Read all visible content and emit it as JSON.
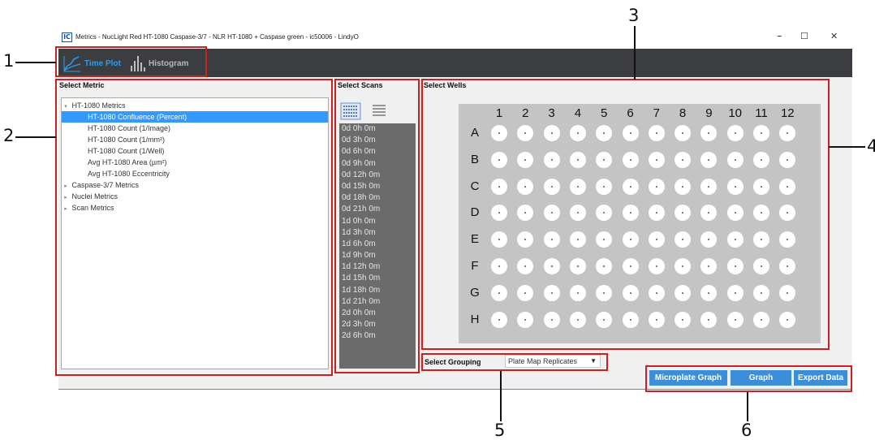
{
  "window": {
    "icon_text": "IC",
    "title": "Metrics - NucLight Red HT-1080 Caspase-3/7 - NLR HT-1080 + Caspase green - ic50006 - LindyO",
    "minimize": "–",
    "maximize": "☐",
    "close": "✕"
  },
  "toolbar": {
    "time_plot": "Time Plot",
    "histogram": "Histogram",
    "active": "Time Plot",
    "active_color": "#2e9dee"
  },
  "select_metric": {
    "label": "Select Metric",
    "tree": [
      {
        "label": "HT-1080 Metrics",
        "expanded": true,
        "level": 0
      },
      {
        "label": "HT-1080 Confluence (Percent)",
        "level": 1,
        "selected": true
      },
      {
        "label": "HT-1080 Count (1/Image)",
        "level": 1
      },
      {
        "label": "HT-1080 Count (1/mm²)",
        "level": 1
      },
      {
        "label": "HT-1080 Count (1/Well)",
        "level": 1
      },
      {
        "label": "Avg HT-1080 Area (µm²)",
        "level": 1
      },
      {
        "label": "Avg HT-1080 Eccentricity",
        "level": 1
      },
      {
        "label": "Caspase-3/7 Metrics",
        "expanded": false,
        "level": 0
      },
      {
        "label": "Nuclei Metrics",
        "expanded": false,
        "level": 0
      },
      {
        "label": "Scan Metrics",
        "expanded": false,
        "level": 0
      }
    ]
  },
  "select_scans": {
    "label": "Select Scans",
    "items": [
      "0d 0h 0m",
      "0d 3h 0m",
      "0d 6h 0m",
      "0d 9h 0m",
      "0d 12h 0m",
      "0d 15h 0m",
      "0d 18h 0m",
      "0d 21h 0m",
      "1d 0h 0m",
      "1d 3h 0m",
      "1d 6h 0m",
      "1d 9h 0m",
      "1d 12h 0m",
      "1d 15h 0m",
      "1d 18h 0m",
      "1d 21h 0m",
      "2d 0h 0m",
      "2d 3h 0m",
      "2d 6h 0m"
    ]
  },
  "select_wells": {
    "label": "Select Wells",
    "columns": [
      "1",
      "2",
      "3",
      "4",
      "5",
      "6",
      "7",
      "8",
      "9",
      "10",
      "11",
      "12"
    ],
    "rows": [
      "A",
      "B",
      "C",
      "D",
      "E",
      "F",
      "G",
      "H"
    ]
  },
  "select_grouping": {
    "label": "Select Grouping",
    "value": "Plate Map Replicates"
  },
  "actions": {
    "microplate_graph": "Microplate Graph",
    "graph": "Graph",
    "export_data": "Export Data"
  },
  "callouts": [
    "1",
    "2",
    "3",
    "4",
    "5",
    "6"
  ],
  "colors": {
    "highlight_box": "#cc1f1f",
    "selection": "#3399ff",
    "button": "#3d8ed9",
    "toolbar_bg": "#3b3d40"
  }
}
